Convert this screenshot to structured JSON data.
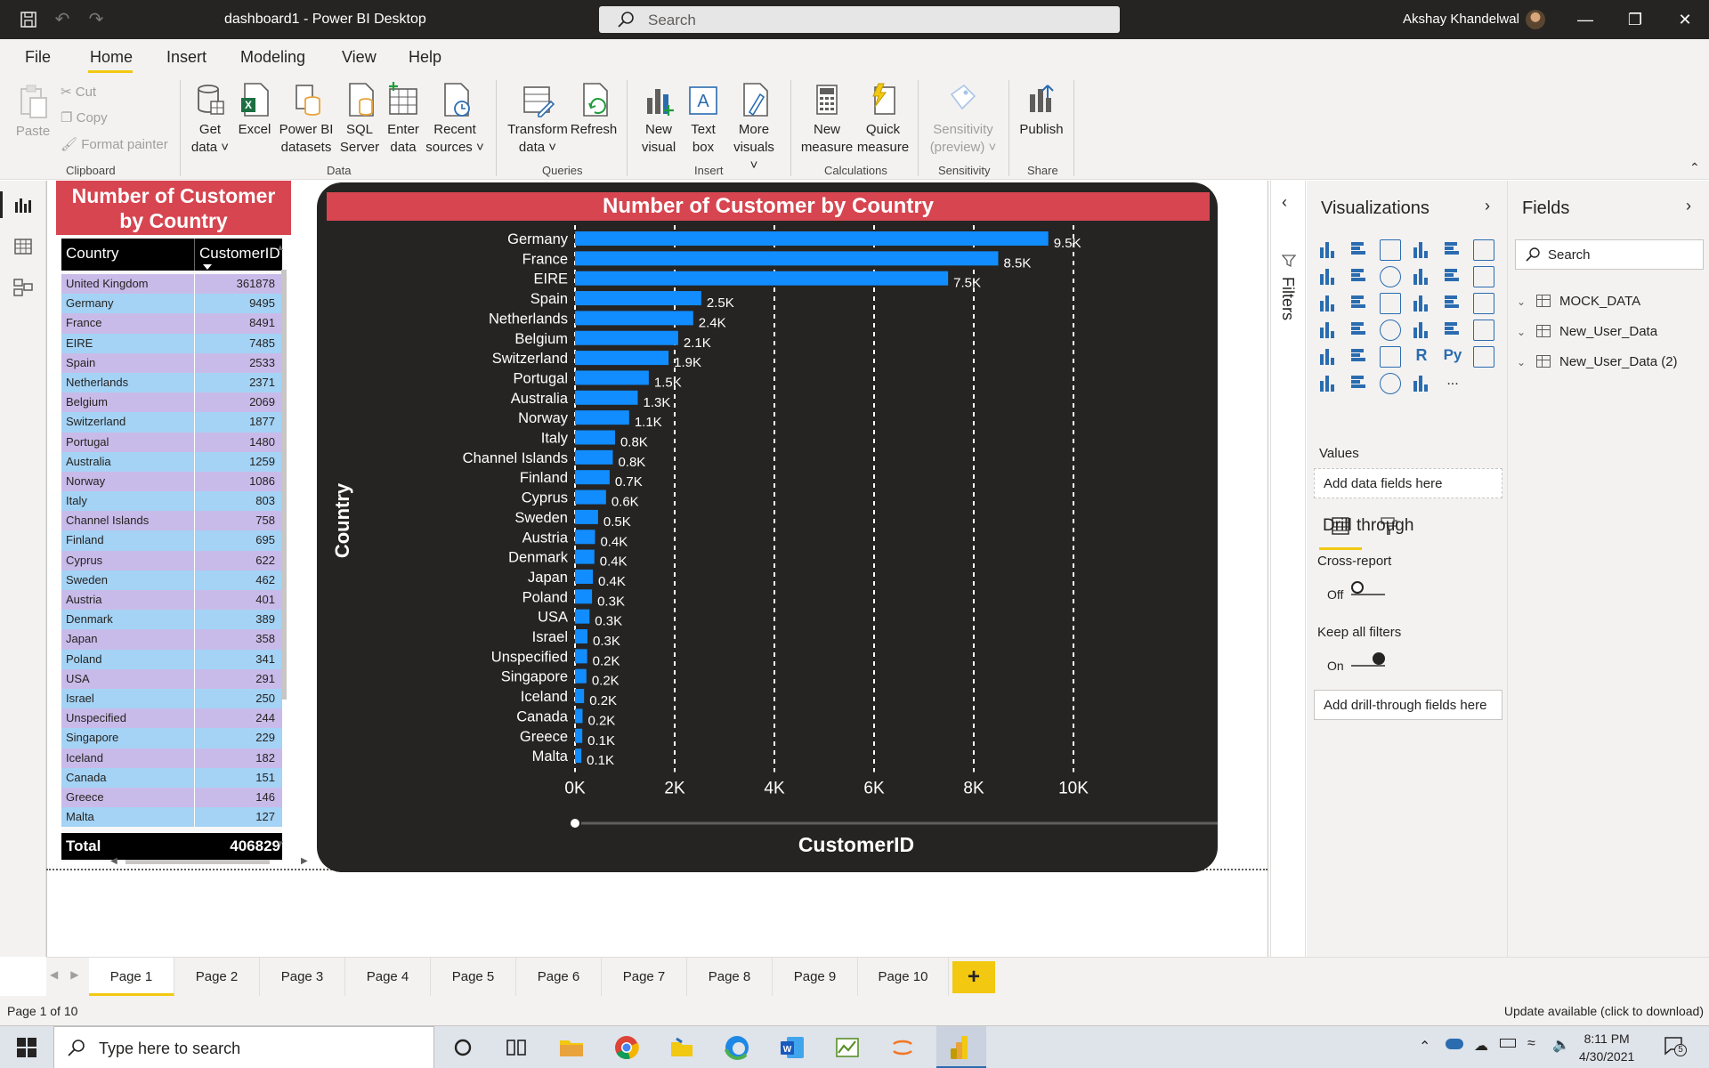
{
  "window": {
    "title": "dashboard1 - Power BI Desktop",
    "search_placeholder": "Search",
    "user": "Akshay Khandelwal"
  },
  "menu": [
    "File",
    "Home",
    "Insert",
    "Modeling",
    "View",
    "Help"
  ],
  "ribbon": {
    "clipboard": {
      "paste": "Paste",
      "cut": "Cut",
      "copy": "Copy",
      "format_painter": "Format painter",
      "label": "Clipboard"
    },
    "data": {
      "get_data": [
        "Get",
        "data"
      ],
      "excel": "Excel",
      "pbi_datasets": [
        "Power BI",
        "datasets"
      ],
      "sql": [
        "SQL",
        "Server"
      ],
      "enter": [
        "Enter",
        "data"
      ],
      "recent": [
        "Recent",
        "sources"
      ],
      "label": "Data"
    },
    "queries": {
      "transform": [
        "Transform",
        "data"
      ],
      "refresh": "Refresh",
      "label": "Queries"
    },
    "insert": {
      "new_visual": [
        "New",
        "visual"
      ],
      "text_box": [
        "Text",
        "box"
      ],
      "more_visuals": [
        "More",
        "visuals"
      ],
      "label": "Insert"
    },
    "calculations": {
      "new_measure": [
        "New",
        "measure"
      ],
      "quick_measure": [
        "Quick",
        "measure"
      ],
      "label": "Calculations"
    },
    "sensitivity": {
      "btn": [
        "Sensitivity",
        "(preview)"
      ],
      "label": "Sensitivity"
    },
    "share": {
      "publish": "Publish",
      "label": "Share"
    }
  },
  "table_visual": {
    "title": "Number of Customer by Country",
    "headers": [
      "Country",
      "CustomerID"
    ],
    "rows": [
      [
        "United Kingdom",
        "361878"
      ],
      [
        "Germany",
        "9495"
      ],
      [
        "France",
        "8491"
      ],
      [
        "EIRE",
        "7485"
      ],
      [
        "Spain",
        "2533"
      ],
      [
        "Netherlands",
        "2371"
      ],
      [
        "Belgium",
        "2069"
      ],
      [
        "Switzerland",
        "1877"
      ],
      [
        "Portugal",
        "1480"
      ],
      [
        "Australia",
        "1259"
      ],
      [
        "Norway",
        "1086"
      ],
      [
        "Italy",
        "803"
      ],
      [
        "Channel Islands",
        "758"
      ],
      [
        "Finland",
        "695"
      ],
      [
        "Cyprus",
        "622"
      ],
      [
        "Sweden",
        "462"
      ],
      [
        "Austria",
        "401"
      ],
      [
        "Denmark",
        "389"
      ],
      [
        "Japan",
        "358"
      ],
      [
        "Poland",
        "341"
      ],
      [
        "USA",
        "291"
      ],
      [
        "Israel",
        "250"
      ],
      [
        "Unspecified",
        "244"
      ],
      [
        "Singapore",
        "229"
      ],
      [
        "Iceland",
        "182"
      ],
      [
        "Canada",
        "151"
      ],
      [
        "Greece",
        "146"
      ],
      [
        "Malta",
        "127"
      ]
    ],
    "total_label": "Total",
    "total_value": "406829"
  },
  "chart_data": {
    "type": "bar",
    "orientation": "horizontal",
    "title": "Number of Customer by Country",
    "xlabel": "CustomerID",
    "ylabel": "Country",
    "xlim": [
      0,
      10000
    ],
    "xticks": [
      "0K",
      "2K",
      "4K",
      "6K",
      "8K",
      "10K"
    ],
    "grid": true,
    "categories": [
      "Germany",
      "France",
      "EIRE",
      "Spain",
      "Netherlands",
      "Belgium",
      "Switzerland",
      "Portugal",
      "Australia",
      "Norway",
      "Italy",
      "Channel Islands",
      "Finland",
      "Cyprus",
      "Sweden",
      "Austria",
      "Denmark",
      "Japan",
      "Poland",
      "USA",
      "Israel",
      "Unspecified",
      "Singapore",
      "Iceland",
      "Canada",
      "Greece",
      "Malta"
    ],
    "values": [
      9495,
      8491,
      7485,
      2533,
      2371,
      2069,
      1877,
      1480,
      1259,
      1086,
      803,
      758,
      695,
      622,
      462,
      401,
      389,
      358,
      341,
      291,
      250,
      244,
      229,
      182,
      151,
      146,
      127
    ],
    "labels": [
      "9.5K",
      "8.5K",
      "7.5K",
      "2.5K",
      "2.4K",
      "2.1K",
      "1.9K",
      "1.5K",
      "1.3K",
      "1.1K",
      "0.8K",
      "0.8K",
      "0.7K",
      "0.6K",
      "0.5K",
      "0.4K",
      "0.4K",
      "0.4K",
      "0.3K",
      "0.3K",
      "0.3K",
      "0.2K",
      "0.2K",
      "0.2K",
      "0.2K",
      "0.1K",
      "0.1K"
    ],
    "bar_color": "#118dff",
    "background": "#252423",
    "title_color": "#d64550"
  },
  "filters_label": "Filters",
  "visualizations": {
    "title": "Visualizations",
    "values_label": "Values",
    "values_well": "Add data fields here",
    "drill_title": "Drill through",
    "cross_report": "Cross-report",
    "cross_state": "Off",
    "keep_filters": "Keep all filters",
    "keep_state": "On",
    "drill_well": "Add drill-through fields here",
    "r_label": "R",
    "py_label": "Py",
    "more": "..."
  },
  "fields": {
    "title": "Fields",
    "search_placeholder": "Search",
    "tables": [
      "MOCK_DATA",
      "New_User_Data",
      "New_User_Data (2)"
    ]
  },
  "pages": [
    "Page 1",
    "Page 2",
    "Page 3",
    "Page 4",
    "Page 5",
    "Page 6",
    "Page 7",
    "Page 8",
    "Page 9",
    "Page 10"
  ],
  "status": {
    "page_info": "Page 1 of 10",
    "update": "Update available (click to download)"
  },
  "taskbar": {
    "search_placeholder": "Type here to search",
    "time": "8:11 PM",
    "date": "4/30/2021",
    "notifications": "5"
  }
}
